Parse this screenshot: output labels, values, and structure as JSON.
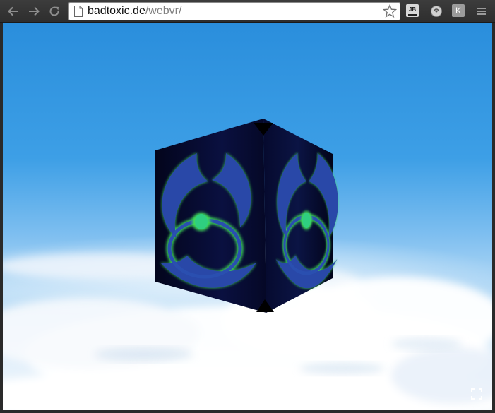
{
  "browser": {
    "url_host": "badtoxic.de",
    "url_path": "/webvr/",
    "extensions": {
      "jb_label": "JB",
      "k_label": "K"
    },
    "icons": [
      "back-arrow-icon",
      "forward-arrow-icon",
      "reload-icon",
      "page-icon",
      "star-icon",
      "menu-icon"
    ]
  },
  "scene": {
    "sky_colors": [
      "#2a8edc",
      "#7fbff0",
      "#f5f9fd"
    ],
    "cube_dark": "#05082a",
    "glow_color": "#3fe05a",
    "symbol_blue": "#2a4fb0",
    "fullscreen_icon": "fullscreen-icon"
  }
}
